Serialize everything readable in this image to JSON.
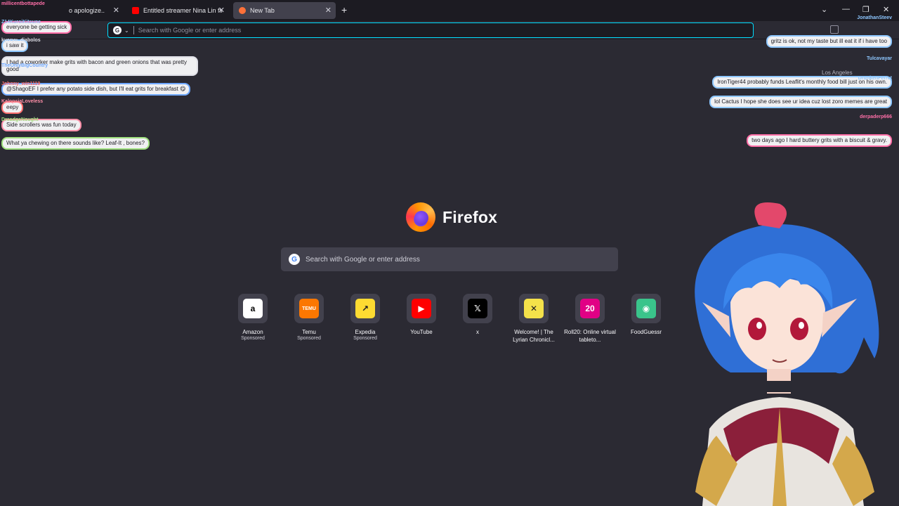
{
  "tabs": [
    {
      "title": "o apologize..",
      "active": false,
      "favicon_color": "#c4c4cc"
    },
    {
      "title": "Entitled streamer Nina Lin finall",
      "active": false,
      "favicon_color": "#ff0000"
    },
    {
      "title": "New Tab",
      "active": true,
      "favicon_color": "#ff7139"
    }
  ],
  "urlbar": {
    "placeholder": "Search with Google or enter address"
  },
  "brand": {
    "name": "Firefox"
  },
  "search": {
    "placeholder": "Search with Google or enter address"
  },
  "tiles": [
    {
      "label": "Amazon",
      "sponsor": "Sponsored",
      "icon": "amazon-icon",
      "bg": "#ffffff",
      "fg": "#000000",
      "glyph": "a"
    },
    {
      "label": "Temu",
      "sponsor": "Sponsored",
      "icon": "temu-icon",
      "bg": "#fb7701",
      "fg": "#ffffff",
      "glyph": "TEMU"
    },
    {
      "label": "Expedia",
      "sponsor": "Sponsored",
      "icon": "expedia-icon",
      "bg": "#fddb32",
      "fg": "#1c1b22",
      "glyph": "↗"
    },
    {
      "label": "YouTube",
      "sponsor": "",
      "icon": "youtube-icon",
      "bg": "#ff0000",
      "fg": "#ffffff",
      "glyph": "▶"
    },
    {
      "label": "x",
      "sponsor": "",
      "icon": "x-icon",
      "bg": "#000000",
      "fg": "#ffffff",
      "glyph": "𝕏"
    },
    {
      "label": "Welcome! | The Lyrian Chronicl...",
      "sponsor": "",
      "icon": "lyrian-icon",
      "bg": "#f4e14a",
      "fg": "#1c1b22",
      "glyph": "✕"
    },
    {
      "label": "Roll20: Online virtual tableto...",
      "sponsor": "",
      "icon": "roll20-icon",
      "bg": "#e10085",
      "fg": "#ffffff",
      "glyph": "20"
    },
    {
      "label": "FoodGuessr",
      "sponsor": "",
      "icon": "foodguessr-icon",
      "bg": "#3ac48b",
      "fg": "#ffffff",
      "glyph": "◉"
    }
  ],
  "chat_left": [
    {
      "user": "millicentbottapede",
      "msg": "everyone be getting sick",
      "color": "#ff6fa8"
    },
    {
      "user": "Z14KuroiKitsune",
      "msg": "i saw it",
      "color": "#8ec7ff"
    },
    {
      "user": "kyoryu_diabolos",
      "msg": "I had a coworker make grits with bacon and green onions that was pretty good",
      "color": "#e0e0e8"
    },
    {
      "user": "TheOnlyBigCountry",
      "msg": "@ShagoEF I prefer any potato side dish, but I'll eat grits for breakfast 😋",
      "color": "#6fa8ff"
    },
    {
      "user": "Johnny_win1119",
      "msg": "eepy",
      "color": "#ff6f6f"
    },
    {
      "user": "KalopsiaLoveless",
      "msg": "Side scrollers was fun today",
      "color": "#ff8fa8"
    },
    {
      "user": "DreadgeNought",
      "msg": "What ya chewing on there sounds like? Leaf-It , bones?",
      "color": "#9fe07f"
    }
  ],
  "chat_right": [
    {
      "user": "JonathanSteev",
      "msg": "gritz is ok, not my taste but ill eat it if i have too",
      "color": "#8ec7ff"
    },
    {
      "user": "Tulcavayar",
      "msg": "IronTiger44 probably funds Leaflit's monthly food bill just on his own.",
      "color": "#8ec7ff"
    },
    {
      "user": "DrunkenFerret",
      "msg": "lol Cactus I hope she does see ur idea cuz lost zoro memes are great",
      "color": "#8ec7ff"
    },
    {
      "user": "derpaderp666",
      "msg": "two days ago I hard buttery grits with a biscuit & gravy.",
      "color": "#ff6fa8"
    }
  ],
  "weather": {
    "location": "Los Angeles"
  }
}
